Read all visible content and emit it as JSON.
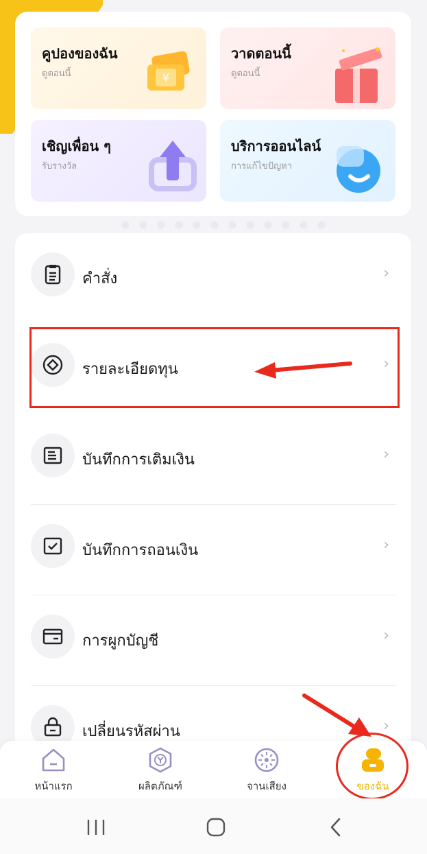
{
  "tiles": {
    "coupon": {
      "title": "คูปองของฉัน",
      "sub": "ดูตอนนี้"
    },
    "draw": {
      "title": "วาดตอนนี้",
      "sub": "ดูตอนนี้"
    },
    "invite": {
      "title": "เชิญเพื่อน ๆ",
      "sub": "รับรางวัล"
    },
    "service": {
      "title": "บริการออนไลน์",
      "sub": "การแก้ไขปัญหา"
    }
  },
  "menu": {
    "items": [
      {
        "label": "คำสั่ง",
        "icon": "clipboard-list-icon"
      },
      {
        "label": "รายละเอียดทุน",
        "icon": "diamond-circle-icon"
      },
      {
        "label": "บันทึกการเติมเงิน",
        "icon": "document-lines-icon"
      },
      {
        "label": "บันทึกการถอนเงิน",
        "icon": "checkbox-icon"
      },
      {
        "label": "การผูกบัญชี",
        "icon": "card-icon"
      },
      {
        "label": "เปลี่ยนรหัสผ่าน",
        "icon": "lock-icon"
      }
    ],
    "chevron": "›"
  },
  "nav": {
    "home": "หน้าแรก",
    "products": "ผลิตภัณฑ์",
    "lottery": "จานเสียง",
    "mine": "ของฉัน"
  },
  "colors": {
    "accent": "#f4b400",
    "annotation": "#e8291c"
  }
}
